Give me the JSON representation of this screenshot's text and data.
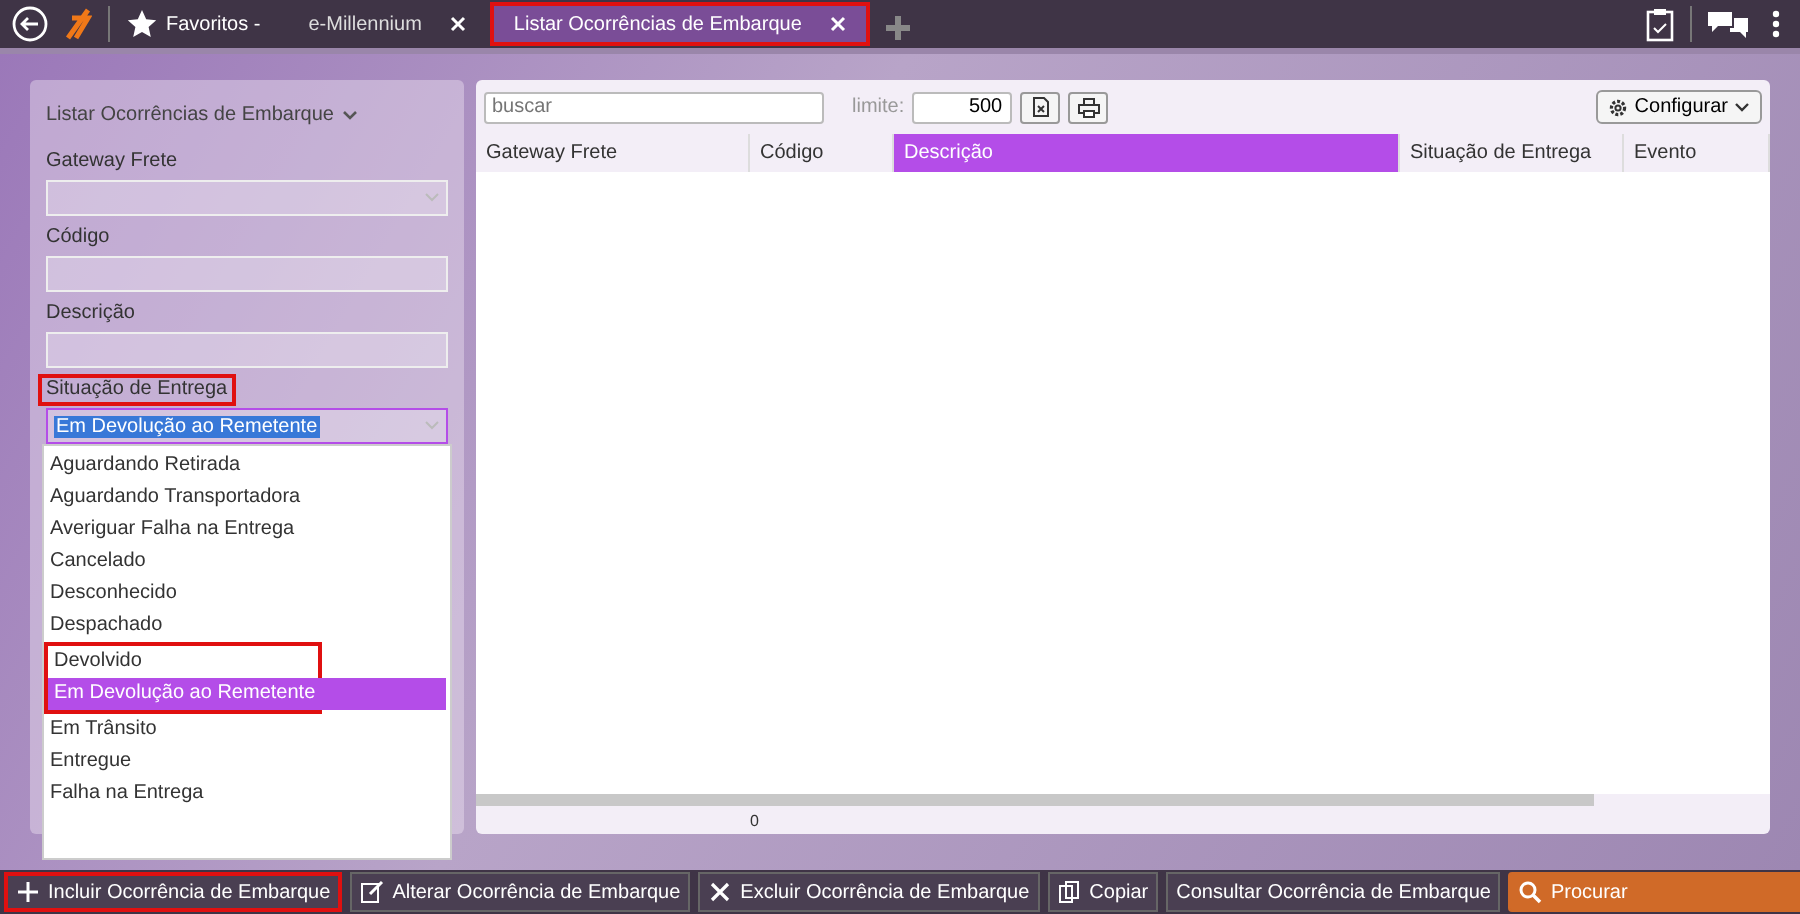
{
  "topbar": {
    "favorites": "Favoritos -",
    "tabs": [
      {
        "label": "e-Millennium",
        "selected": false,
        "highlighted": false
      },
      {
        "label": "Listar Ocorrências de Embarque",
        "selected": true,
        "highlighted": true
      }
    ]
  },
  "filter_panel": {
    "title": "Listar Ocorrências de Embarque",
    "fields": [
      {
        "label": "Gateway Frete",
        "kind": "select",
        "highlighted": false
      },
      {
        "label": "Código",
        "kind": "text",
        "highlighted": false
      },
      {
        "label": "Descrição",
        "kind": "text",
        "highlighted": false
      },
      {
        "label": "Situação de Entrega",
        "kind": "select",
        "value": "Em Devolução ao Remetente",
        "highlighted": true,
        "expanded": true
      }
    ],
    "options": [
      {
        "label": "Aguardando Retirada",
        "selected": false,
        "highlighted": false
      },
      {
        "label": "Aguardando Transportadora",
        "selected": false,
        "highlighted": false
      },
      {
        "label": "Averiguar Falha na Entrega",
        "selected": false,
        "highlighted": false
      },
      {
        "label": "Cancelado",
        "selected": false,
        "highlighted": false
      },
      {
        "label": "Desconhecido",
        "selected": false,
        "highlighted": false
      },
      {
        "label": "Despachado",
        "selected": false,
        "highlighted": false
      },
      {
        "label": "Devolvido",
        "selected": false,
        "highlighted": true
      },
      {
        "label": "Em Devolução ao Remetente",
        "selected": true,
        "highlighted": true
      },
      {
        "label": "Em Trânsito",
        "selected": false,
        "highlighted": false
      },
      {
        "label": "Entregue",
        "selected": false,
        "highlighted": false
      },
      {
        "label": "Falha na Entrega",
        "selected": false,
        "highlighted": false
      }
    ]
  },
  "grid": {
    "search_placeholder": "buscar",
    "limit_label": "limite:",
    "limit_value": "500",
    "configure": "Configurar",
    "columns": [
      {
        "label": "Gateway Frete",
        "selected": false
      },
      {
        "label": "Código",
        "selected": false
      },
      {
        "label": "Descrição",
        "selected": true
      },
      {
        "label": "Situação de Entrega",
        "selected": false
      },
      {
        "label": "Evento",
        "selected": false
      }
    ],
    "footer_count": "0"
  },
  "actions": [
    {
      "label": "Incluir Ocorrência de Embarque",
      "kind": "add",
      "highlighted": true
    },
    {
      "label": "Alterar Ocorrência de Embarque",
      "kind": "edit",
      "highlighted": false
    },
    {
      "label": "Excluir Ocorrência de Embarque",
      "kind": "delete",
      "highlighted": false
    },
    {
      "label": "Copiar",
      "kind": "copy",
      "highlighted": false
    },
    {
      "label": "Consultar Ocorrência de Embarque",
      "kind": "plain",
      "highlighted": false
    },
    {
      "label": "Procurar",
      "kind": "search",
      "highlighted": false
    }
  ]
}
